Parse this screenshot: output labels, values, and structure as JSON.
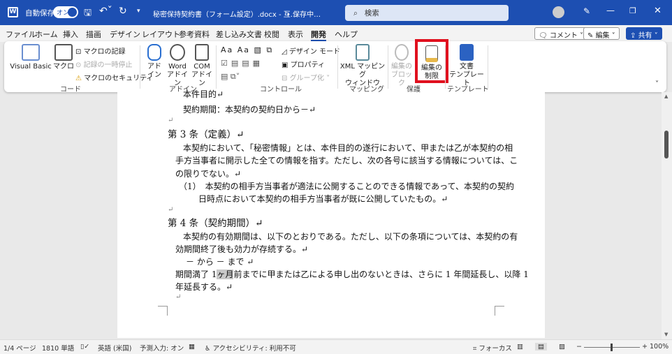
{
  "titlebar": {
    "autosave_label": "自動保存",
    "autosave_state": "オン",
    "doc_title": "秘密保持契約書（フォーム設定）.docx - 互…",
    "save_status": "• 保存中…",
    "search_placeholder": "検索"
  },
  "tabs": [
    "ファイル",
    "ホーム",
    "挿入",
    "描画",
    "デザイン",
    "レイアウト",
    "参考資料",
    "差し込み文書",
    "校閲",
    "表示",
    "開発",
    "ヘルプ"
  ],
  "active_tab": "開発",
  "actions": {
    "comment": "コメント",
    "edit": "編集",
    "share": "共有"
  },
  "ribbon": {
    "code": {
      "label": "コード",
      "visual_basic": "Visual Basic",
      "macro": "マクロ",
      "record": "マクロの記録",
      "pause": "記録の一時停止",
      "security": "マクロのセキュリティ"
    },
    "addins": {
      "label": "アドイン",
      "addin": "アド\nイン",
      "word_addin": "Word\nアドイン",
      "com_addin": "COM\nアドイン"
    },
    "controls": {
      "label": "コントロール",
      "design_mode": "デザイン モード",
      "properties": "プロパティ",
      "group": "グループ化"
    },
    "mapping": {
      "label": "マッピング",
      "xml": "XML マッピング\nウィンドウ"
    },
    "protect": {
      "label": "保護",
      "block": "編集の\nブロック",
      "restrict": "編集の\n制限"
    },
    "template": {
      "label": "テンプレート",
      "doc_template": "文書\nテンプレート"
    }
  },
  "highlight_color": "#e0101e",
  "document": {
    "lines": [
      "本件目的↵",
      "契約期間：本契約の契約日から－↵",
      "↵",
      "第 3 条（定義）↵",
      "本契約において、「秘密情報」とは、本件目的の遂行において、甲または乙が本契約の相",
      "手方当事者に開示した全ての情報を指す。ただし、次の各号に該当する情報については、こ",
      "の限りでない。↵",
      "（1）　本契約の相手方当事者が適法に公開することのできる情報であって、本契約の契約",
      "日時点において本契約の相手方当事者が既に公開していたもの。↵",
      "↵",
      "第 4 条（契約期間）↵",
      "本契約の有効期間は、以下のとおりである。ただし、以下の条項については、本契約の有",
      "効期間終了後も効力が存続する。↵",
      "－ から － まで ↵"
    ],
    "line_pre": "期間満了 1",
    "line_field": "ヶ月",
    "line_post": "前までに甲または乙による申し出のないときは、さらに 1 年間延長し、以降 1",
    "line_last": "年延長する。↵",
    "line_end": "↵"
  },
  "status": {
    "page": "1/4 ページ",
    "words": "1810 単語",
    "language": "英語 (米国)",
    "predict": "予測入力: オン",
    "accessibility": "アクセシビリティ: 利用不可",
    "focus": "フォーカス",
    "zoom": "100%",
    "zoom_level": 100
  }
}
